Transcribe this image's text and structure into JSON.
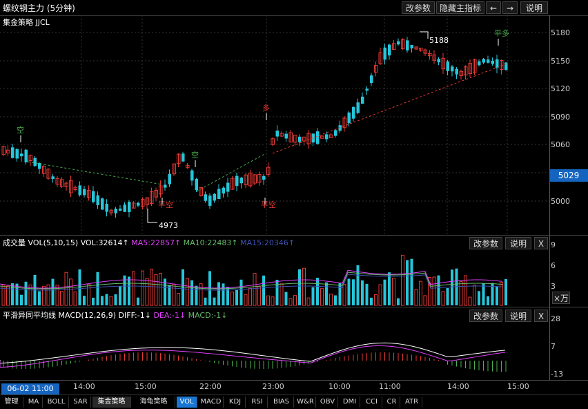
{
  "header": {
    "title": "螺纹钢主力 (5分钟)",
    "buttons": [
      "改参数",
      "隐藏主指标",
      "←",
      "→",
      "说明"
    ]
  },
  "main_panel": {
    "strategy_label": "集金策略 JJCL",
    "price_axis": [
      "5180",
      "5150",
      "5120",
      "5090",
      "5060",
      "5030",
      "5000"
    ],
    "current_price": "5029",
    "annotations": {
      "high_value": "5188",
      "low_value": "4973",
      "signals": [
        "空",
        "平空",
        "空",
        "多",
        "平空",
        "平多"
      ]
    }
  },
  "volume_panel": {
    "label": "成交量 VOL(5,10,15)",
    "vol": "VOL:32614↑",
    "ma5": "MA5:22857↑",
    "ma10": "MA10:22483↑",
    "ma15": "MA15:20346↑",
    "axis": [
      "9",
      "6",
      "3"
    ],
    "unit_button": "×万",
    "buttons": [
      "改参数",
      "说明",
      "X"
    ]
  },
  "macd_panel": {
    "label": "平滑异同平均线 MACD(12,26,9)",
    "diff": "DIFF:-1↓",
    "dea": "DEA:-1↓",
    "macd": "MACD:-1↓",
    "axis": [
      "28",
      "7",
      "-13"
    ],
    "buttons": [
      "改参数",
      "说明",
      "X"
    ]
  },
  "time_axis": {
    "current": "06-02 11:00",
    "ticks": [
      "14:00",
      "15:00",
      "22:00",
      "23:00",
      "10:00",
      "11:00",
      "14:00",
      "15:00"
    ]
  },
  "tabs": [
    "管理",
    "MA",
    "BOLL",
    "SAR",
    "集金策略",
    "海龟策略",
    "VOL",
    "MACD",
    "KDJ",
    "RSI",
    "BIAS",
    "W&R",
    "OBV",
    "DMI",
    "CCI",
    "CR",
    "ATR"
  ],
  "colors": {
    "up": "#e53935",
    "down": "#26c6da",
    "signal_buy": "#e53935",
    "signal_sell": "#4caf50",
    "ma5": "#e040fb",
    "ma10": "#66bb6a",
    "ma15": "#3f51b5"
  }
}
